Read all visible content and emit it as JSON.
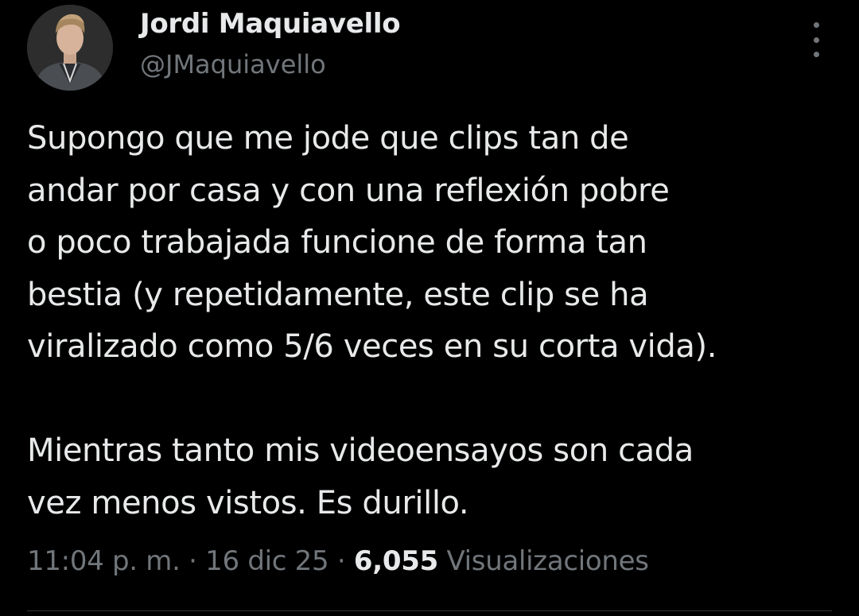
{
  "author": {
    "display_name": "Jordi Maquiavello",
    "handle": "@JMaquiavello"
  },
  "tweet": {
    "text": "Supongo que me jode que clips tan de\nandar por casa y con una reflexión pobre\no poco trabajada funcione de forma tan\nbestia (y repetidamente, este clip se ha\nviralizado como 5/6 veces en su corta vida).\n\nMientras tanto mis videoensayos son cada\nvez menos vistos. Es durillo.",
    "time": "11:04 p. m.",
    "separator": "·",
    "date": "16 dic 25",
    "views_count": "6,055",
    "views_label": "Visualizaciones"
  },
  "icons": {
    "more": "more-options-icon"
  },
  "colors": {
    "background": "#000000",
    "primary_text": "#e7e9ea",
    "secondary_text": "#71767b",
    "divider": "#2f3336"
  }
}
